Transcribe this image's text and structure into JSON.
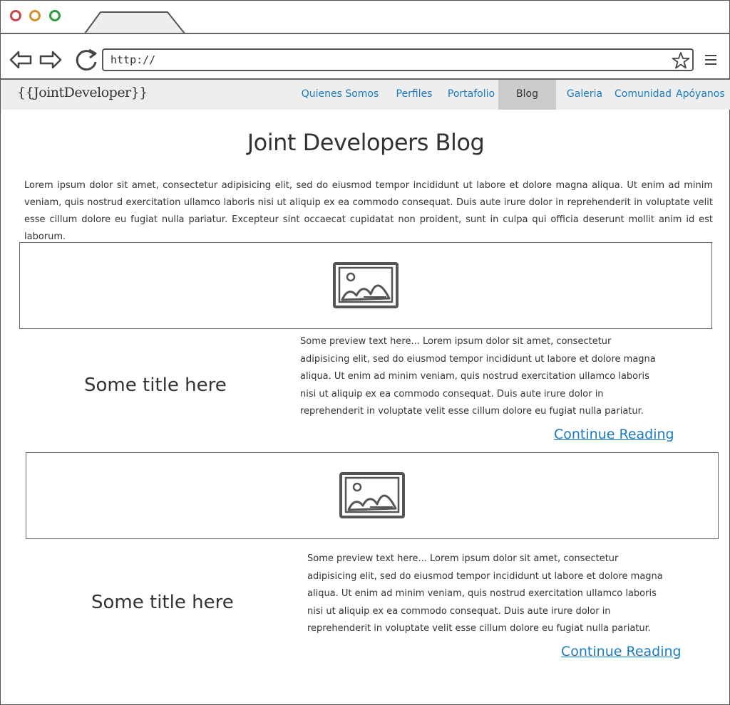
{
  "browser": {
    "url": "http://",
    "icons": {
      "back": "back-arrow-icon",
      "forward": "forward-arrow-icon",
      "reload": "reload-icon",
      "bookmark": "star-icon",
      "menu": "hamburger-menu-icon"
    },
    "window_controls": {
      "close_color": "#c8474f",
      "minimize_color": "#d2902a",
      "maximize_color": "#2c9c3a"
    }
  },
  "site_nav": {
    "brand": "{{JointDeveloper}}",
    "items": [
      {
        "label": "Quienes Somos",
        "active": false
      },
      {
        "label": "Perfiles",
        "active": false
      },
      {
        "label": "Portafolio",
        "active": false
      },
      {
        "label": "Blog",
        "active": true
      },
      {
        "label": "Galeria",
        "active": false
      },
      {
        "label": "Comunidad",
        "active": false
      },
      {
        "label": "Apóyanos",
        "active": false
      }
    ],
    "link_color": "#1a7ac0",
    "active_bg": "#cccccc"
  },
  "page": {
    "title": "Joint Developers Blog",
    "intro": "Lorem ipsum dolor sit amet, consectetur adipisicing elit, sed do eiusmod tempor incididunt ut labore et dolore magna aliqua. Ut enim ad minim veniam, quis nostrud exercitation ullamco laboris nisi ut aliquip ex ea commodo consequat. Duis aute irure dolor in reprehenderit in voluptate velit esse cillum dolore eu fugiat nulla pariatur. Excepteur sint occaecat cupidatat non proident, sunt in culpa qui officia deserunt mollit anim id est laborum."
  },
  "posts": [
    {
      "title": "Some title here",
      "preview": "Some preview text here... Lorem ipsum dolor sit amet, consectetur adipisicing elit, sed do eiusmod tempor incididunt ut labore et dolore magna aliqua. Ut enim ad minim veniam, quis nostrud exercitation ullamco laboris nisi ut aliquip ex ea commodo consequat. Duis aute irure dolor in reprehenderit in voluptate velit esse cillum dolore eu fugiat nulla pariatur.",
      "continue_label": "Continue Reading",
      "image_icon": "image-placeholder-icon"
    },
    {
      "title": "Some title here",
      "preview": "Some preview text here... Lorem ipsum dolor sit amet, consectetur adipisicing elit, sed do eiusmod tempor incididunt ut labore et dolore magna aliqua. Ut enim ad minim veniam, quis nostrud exercitation ullamco laboris nisi ut aliquip ex ea commodo consequat. Duis aute irure dolor in reprehenderit in voluptate velit esse cillum dolore eu fugiat nulla pariatur.",
      "continue_label": "Continue Reading",
      "image_icon": "image-placeholder-icon"
    }
  ]
}
